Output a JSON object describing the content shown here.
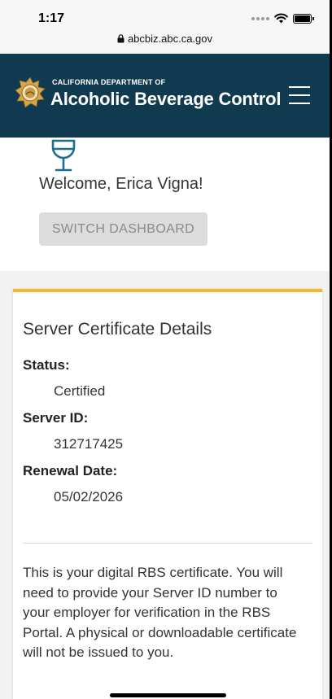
{
  "status_bar": {
    "time": "1:17",
    "url": "abcbiz.abc.ca.gov"
  },
  "header": {
    "department": "CALIFORNIA DEPARTMENT OF",
    "brand": "Alcoholic Beverage Control",
    "colors": {
      "background": "#0f3a4f",
      "accent": "#f4b633"
    }
  },
  "welcome": {
    "icon": "wine-glass-icon",
    "greeting": "Welcome, Erica Vigna!",
    "switch_button": "SWITCH DASHBOARD"
  },
  "certificate": {
    "title": "Server Certificate Details",
    "fields": [
      {
        "label": "Status:",
        "value": "Certified"
      },
      {
        "label": "Server ID:",
        "value": "312717425"
      },
      {
        "label": "Renewal Date:",
        "value": "05/02/2026"
      }
    ],
    "note": "This is your digital RBS certificate. You will need to provide your Server ID number to your employer for verification in the RBS Portal. A physical or downloadable certificate will not be issued to you."
  }
}
